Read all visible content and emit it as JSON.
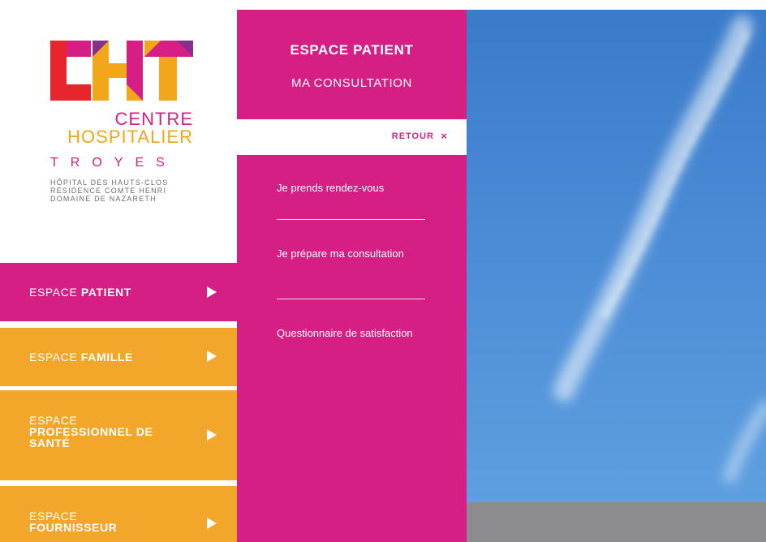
{
  "logo": {
    "line1": "CENTRE",
    "line2": "HOSPITALIER",
    "line3": "TROYES",
    "sub": [
      "HÔPITAL DES HAUTS-CLOS",
      "RÉSIDENCE COMTE HENRI",
      "DOMAINE DE NAZARETH"
    ],
    "colors": {
      "magenta": "#d51f84",
      "orange": "#f2a71b",
      "red": "#e6252d",
      "purple": "#8a2e8c"
    }
  },
  "nav": {
    "patient": {
      "light": "ESPACE ",
      "bold": "PATIENT"
    },
    "famille": {
      "light": "ESPACE ",
      "bold": "FAMILLE"
    },
    "pro": {
      "light": "ESPACE",
      "bold1": "PROFESSIONNEL DE",
      "bold2": "SANTÉ"
    },
    "fournisseur": {
      "light": "ESPACE",
      "bold": "FOURNISSEUR"
    }
  },
  "panel": {
    "title": "ESPACE PATIENT",
    "subtitle": "MA CONSULTATION",
    "retour": "RETOUR",
    "close": "×",
    "links": [
      "Je prends rendez-vous",
      "Je prépare ma consultation",
      "Questionnaire de satisfaction"
    ]
  },
  "theme": {
    "magenta": "#d51f84",
    "orange": "#f2a72b",
    "sky": "#4a8bd6",
    "grey": "#8c8c8e"
  },
  "icons": {
    "nav_arrow": "triangle-right-icon",
    "retour_close": "close-icon"
  }
}
